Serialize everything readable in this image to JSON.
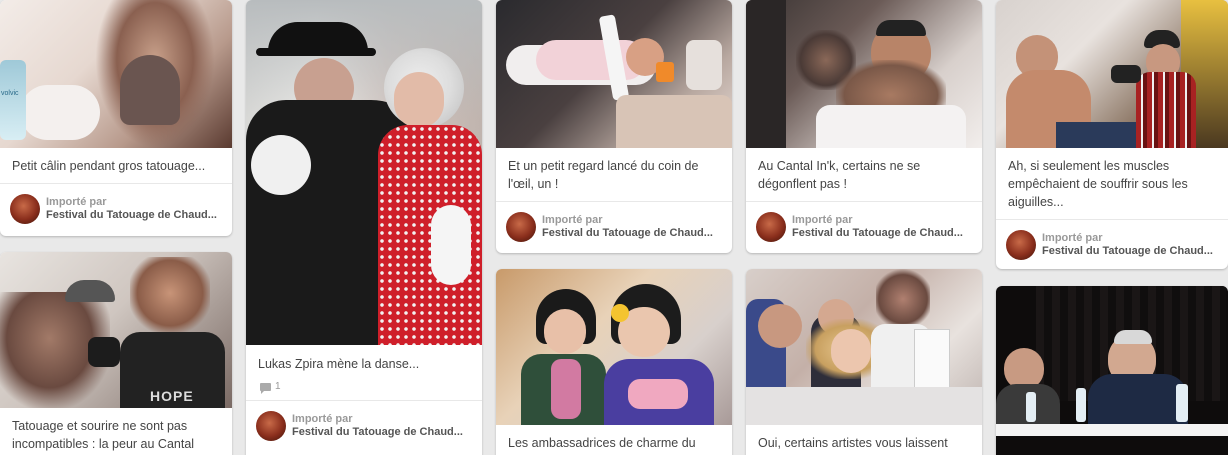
{
  "pins": [
    {
      "description": "Petit câlin pendant gros tatouage...",
      "imported_by": "Importé par",
      "board": "Festival du Tatouage de Chaud...",
      "comments": null
    },
    {
      "description": "Tatouage et sourire ne sont pas incompatibles : la peur au Cantal",
      "imported_by": null,
      "board": null,
      "comments": null
    },
    {
      "description": "Lukas Zpira mène la danse...",
      "imported_by": "Importé par",
      "board": "Festival du Tatouage de Chaud...",
      "comments": "1"
    },
    {
      "description": "Et un petit regard lancé du coin de l'œil, un !",
      "imported_by": "Importé par",
      "board": "Festival du Tatouage de Chaud...",
      "comments": null
    },
    {
      "description": "Les ambassadrices de charme du",
      "imported_by": null,
      "board": null,
      "comments": null
    },
    {
      "description": "Au Cantal In'k, certains ne se dégonflent pas !",
      "imported_by": "Importé par",
      "board": "Festival du Tatouage de Chaud...",
      "comments": null
    },
    {
      "description": "Oui, certains artistes vous laissent",
      "imported_by": null,
      "board": null,
      "comments": null
    },
    {
      "description": "Ah, si seulement les muscles empêchaient de souffrir sous les aiguilles...",
      "imported_by": "Importé par",
      "board": "Festival du Tatouage de Chaud...",
      "comments": null
    },
    {
      "description": "",
      "imported_by": null,
      "board": null,
      "comments": null
    }
  ],
  "photo_marks": {
    "water_bottle_label": "volvic",
    "tshirt_text": "HOPE"
  },
  "icons": {
    "comment": "comment-bubble-icon",
    "avatar": "board-avatar"
  }
}
